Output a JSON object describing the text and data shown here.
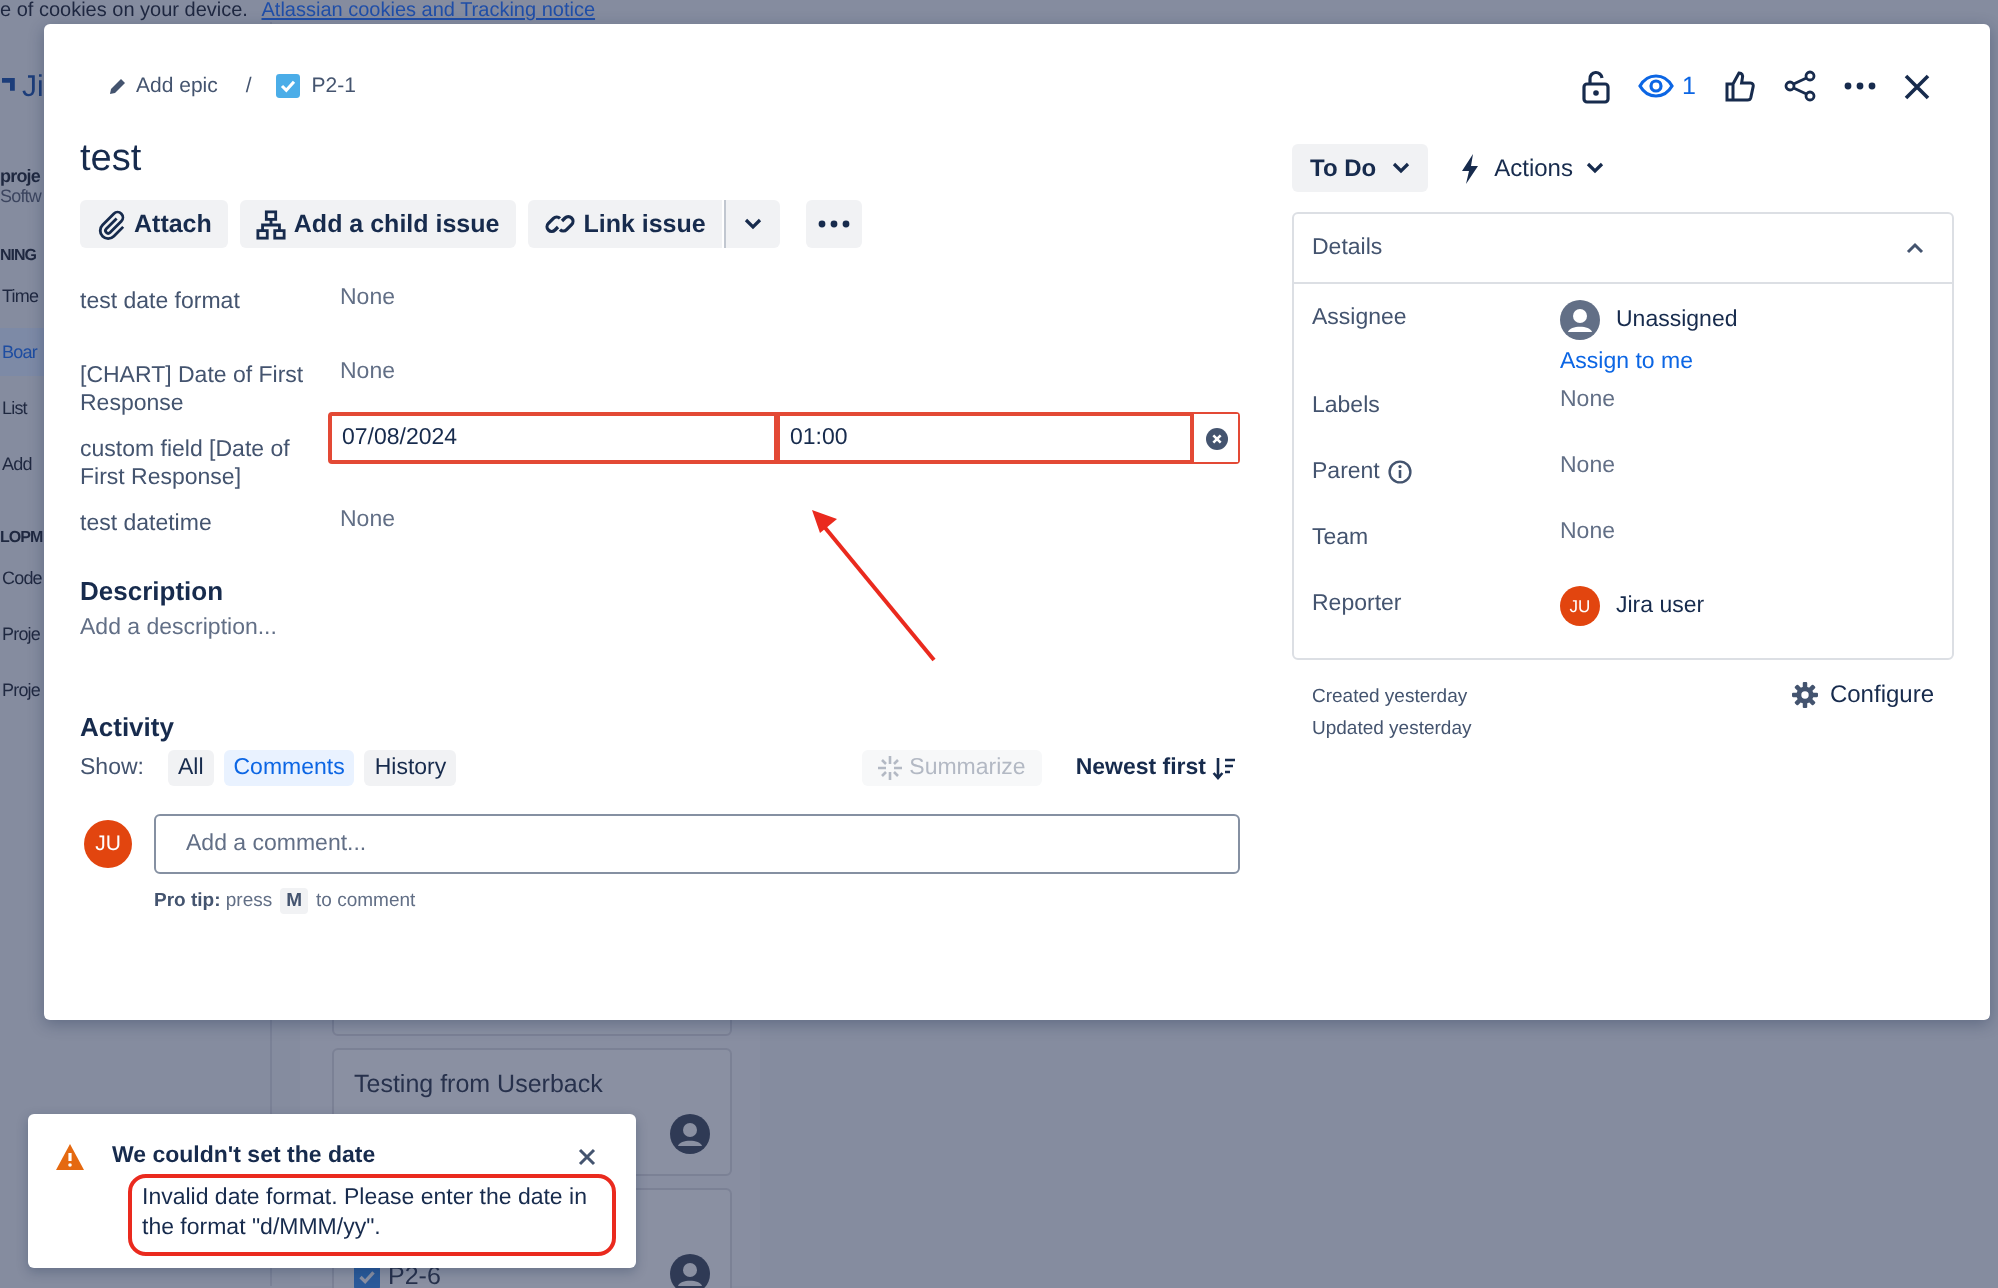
{
  "cookie_banner": {
    "text": "e of cookies on your device.",
    "link": "Atlassian cookies and Tracking notice"
  },
  "sidebar": {
    "logo_text": "Ji",
    "project_name": "proje",
    "project_type": "Softw",
    "items": [
      {
        "kind": "heading",
        "label": "NING",
        "selected": false
      },
      {
        "kind": "item",
        "label": "Time",
        "selected": false
      },
      {
        "kind": "item",
        "label": "Boar",
        "selected": true
      },
      {
        "kind": "item",
        "label": "List",
        "selected": false
      },
      {
        "kind": "item",
        "label": "Add",
        "selected": false
      },
      {
        "kind": "heading",
        "label": "LOPM",
        "selected": false
      },
      {
        "kind": "item",
        "label": "Code",
        "selected": false
      },
      {
        "kind": "item",
        "label": "Proje",
        "selected": false
      },
      {
        "kind": "item",
        "label": "Proje",
        "selected": false
      }
    ]
  },
  "board": {
    "cards": [
      {
        "kind": "title",
        "text": "Testing from Userback"
      },
      {
        "kind": "key",
        "text": "P2-6"
      }
    ]
  },
  "modal": {
    "breadcrumb": {
      "epic": "Add epic",
      "separator": "/",
      "issue_key": "P2-1"
    },
    "watchers": "1",
    "title": "test",
    "buttons": [
      {
        "kind": "attach",
        "label": "Attach"
      },
      {
        "kind": "child",
        "label": "Add a child issue"
      },
      {
        "kind": "link",
        "label": "Link issue"
      }
    ],
    "fields": [
      {
        "kind": "text",
        "label": "test date format",
        "value": "None"
      },
      {
        "kind": "text",
        "label": "[CHART] Date of First Response",
        "value": "None"
      },
      {
        "kind": "datetime",
        "label": "custom field [Date of First Response]",
        "date": "07/08/2024",
        "time": "01:00",
        "invalid": true
      },
      {
        "kind": "text",
        "label": "test datetime",
        "value": "None"
      }
    ],
    "description": {
      "heading": "Description",
      "placeholder": "Add a description..."
    },
    "activity": {
      "heading": "Activity",
      "show_label": "Show:",
      "filters": [
        {
          "label": "All",
          "selected": false
        },
        {
          "label": "Comments",
          "selected": true
        },
        {
          "label": "History",
          "selected": false
        }
      ],
      "summarize": {
        "label": "Summarize",
        "disabled": true
      },
      "sort": "Newest first",
      "comment": {
        "avatar": "JU",
        "placeholder": "Add a comment...",
        "tip": "**Pro tip:** press",
        "tip_key": "M",
        "tip_suffix": "to comment"
      }
    },
    "status": {
      "label": "To Do"
    },
    "actions": {
      "label": "Actions"
    },
    "details": {
      "heading": "Details",
      "expanded": true,
      "rows": [
        {
          "kind": "assignee",
          "label": "Assignee",
          "value": "Unassigned",
          "link": "Assign to me"
        },
        {
          "kind": "text",
          "label": "Labels",
          "value": "None"
        },
        {
          "kind": "text",
          "label": "Parent",
          "value": "None",
          "info": true
        },
        {
          "kind": "text",
          "label": "Team",
          "value": "None"
        },
        {
          "kind": "user",
          "label": "Reporter",
          "avatar": "JU",
          "value": "Jira user"
        }
      ]
    },
    "created": "Created yesterday",
    "updated": "Updated yesterday",
    "configure": "Configure"
  },
  "toast": {
    "title": "We couldn't set the date",
    "message": "Invalid date format. Please enter the date in the format \"d/MMM/yy\"."
  }
}
